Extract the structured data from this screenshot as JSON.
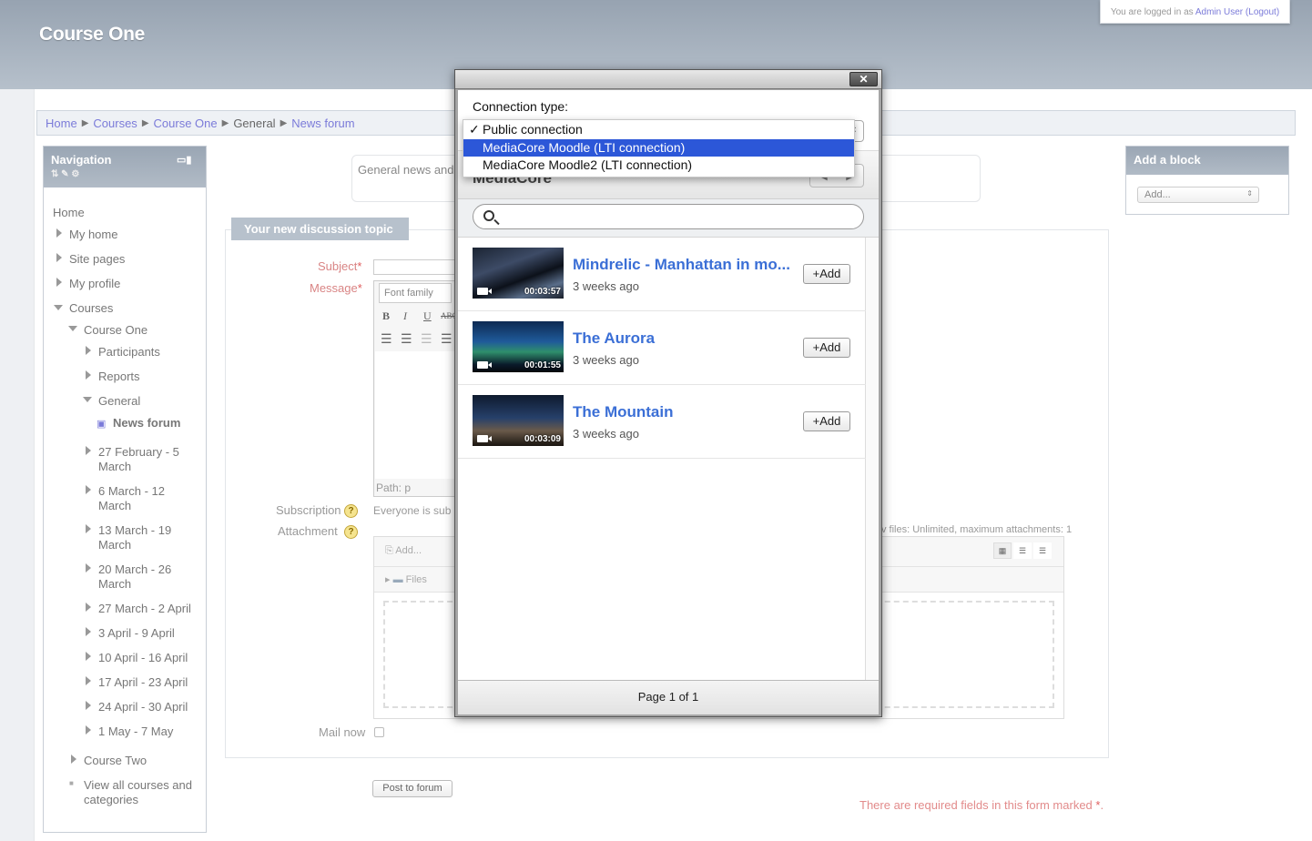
{
  "header": {
    "site_title": "Course One",
    "login_prefix": "You are logged in as",
    "login_user": "Admin User",
    "logout": "(Logout)"
  },
  "breadcrumb": [
    "Home",
    "Courses",
    "Course One",
    "General",
    "News forum"
  ],
  "navigation": {
    "title": "Navigation",
    "items": {
      "home": "Home",
      "my_home": "My home",
      "site_pages": "Site pages",
      "my_profile": "My profile",
      "courses": "Courses",
      "course_one": "Course One",
      "participants": "Participants",
      "reports": "Reports",
      "general": "General",
      "news_forum": "News forum",
      "w1a": "27 February - 5",
      "w1b": "March",
      "w2a": "6 March - 12",
      "w2b": "March",
      "w3a": "13 March - 19",
      "w3b": "March",
      "w4a": "20 March - 26",
      "w4b": "March",
      "w5": "27 March - 2 April",
      "w6": "3 April - 9 April",
      "w7": "10 April - 16 April",
      "w8": "17 April - 23 April",
      "w9": "24 April - 30 April",
      "w10": "1 May - 7 May",
      "course_two": "Course Two",
      "view_all_a": "View all courses and",
      "view_all_b": "categories"
    }
  },
  "forum": {
    "intro": "General news and",
    "tab": "Your new discussion topic",
    "subject_label": "Subject",
    "message_label": "Message",
    "font_family": "Font family",
    "path": "Path: p",
    "subscription_label": "Subscription",
    "subscription_text": "Everyone is sub",
    "attachment_label": "Attachment",
    "files_info": "v files: Unlimited, maximum attachments: 1",
    "fp_add": "Add...",
    "fp_files": "Files",
    "mail_now": "Mail now",
    "post_button": "Post to forum",
    "required_note": "There are required fields in this form marked",
    "required_star": "*",
    "period": "."
  },
  "add_block": {
    "title": "Add a block",
    "select": "Add..."
  },
  "dialog": {
    "close": "✕",
    "connection_label": "Connection type:",
    "connection_options": [
      "Public connection",
      "MediaCore Moodle (LTI connection)",
      "MediaCore Moodle2 (LTI connection)"
    ],
    "selected_index": 1,
    "checked_index": 0,
    "header_title": "MediaCore",
    "search_placeholder": "",
    "add_label": "+Add",
    "media": [
      {
        "title": "Mindrelic - Manhattan in mo...",
        "time": "3 weeks ago",
        "duration": "00:03:57"
      },
      {
        "title": "The Aurora",
        "time": "3 weeks ago",
        "duration": "00:01:55"
      },
      {
        "title": "The Mountain",
        "time": "3 weeks ago",
        "duration": "00:03:09"
      }
    ],
    "pager": "Page 1 of 1"
  }
}
